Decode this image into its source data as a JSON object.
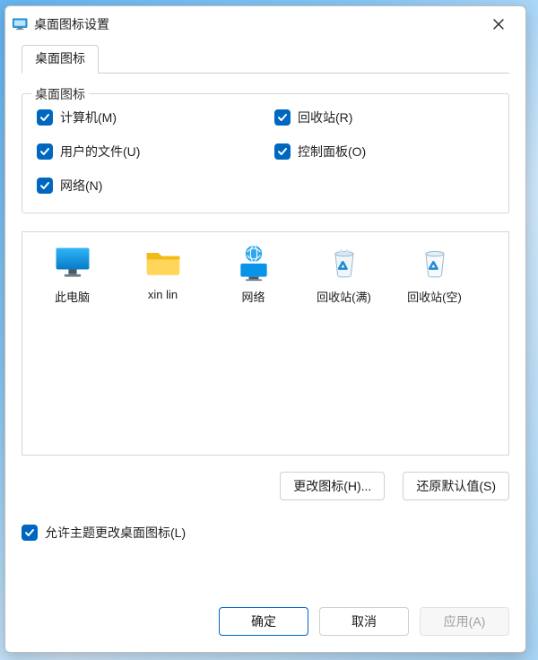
{
  "title": "桌面图标设置",
  "tab_label": "桌面图标",
  "group_title": "桌面图标",
  "checkboxes": {
    "computer": "计算机(M)",
    "recycle": "回收站(R)",
    "userfiles": "用户的文件(U)",
    "controlpanel": "控制面板(O)",
    "network": "网络(N)"
  },
  "icons": {
    "thispc": "此电脑",
    "user": "xin lin",
    "network": "网络",
    "recycle_full": "回收站(满)",
    "recycle_empty": "回收站(空)"
  },
  "buttons": {
    "change_icon": "更改图标(H)...",
    "restore_default": "还原默认值(S)",
    "ok": "确定",
    "cancel": "取消",
    "apply": "应用(A)"
  },
  "allow_themes": "允许主题更改桌面图标(L)"
}
